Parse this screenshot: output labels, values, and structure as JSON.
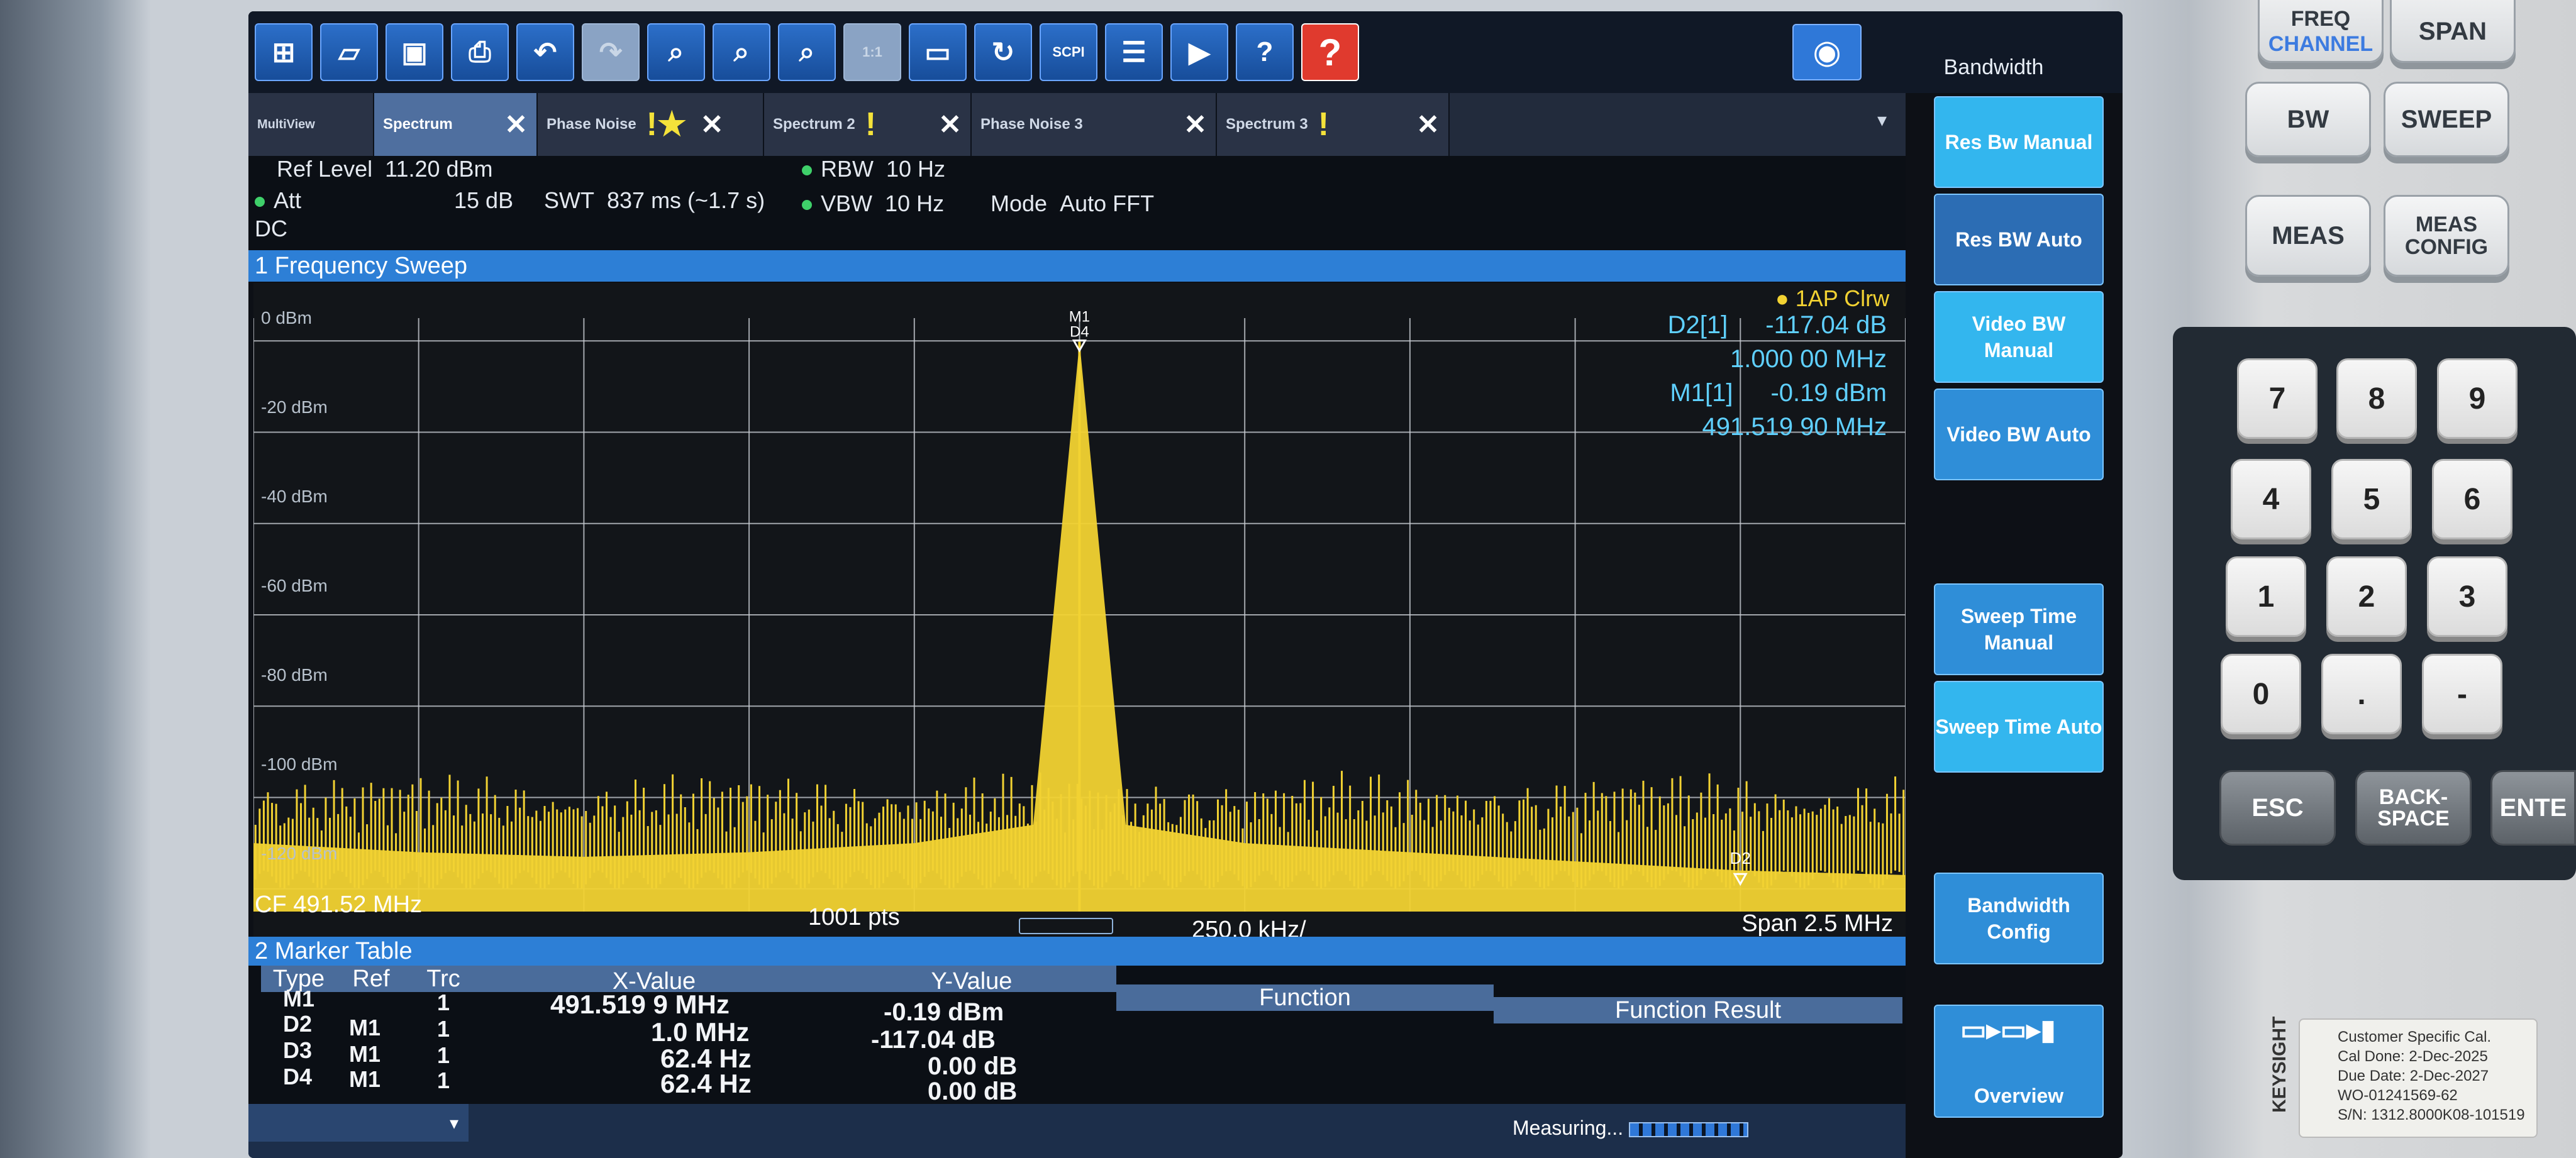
{
  "toolbar": {
    "icons": [
      "windows-icon",
      "open-folder-icon",
      "save-icon",
      "print-icon",
      "undo-icon",
      "redo-icon",
      "zoom-icon",
      "zoom-multi-icon",
      "zoom-off-icon",
      "zoom-1to1-icon",
      "full-screen-icon",
      "refresh-icon",
      "scpi-recorder-icon",
      "sequencer-icon",
      "display-icon",
      "help-pointer-icon",
      "help-icon"
    ],
    "scpi_label": "SCPI",
    "zoom_1to1_label": "1:1"
  },
  "softkey_panel": {
    "title": "Bandwidth",
    "keys": [
      {
        "label": "Res Bw Manual",
        "active": true
      },
      {
        "label": "Res BW Auto",
        "active": false
      },
      {
        "label": "Video BW Manual",
        "active": true
      },
      {
        "label": "Video BW Auto",
        "active": false
      },
      {
        "label": "Sweep Time Manual",
        "active": false
      },
      {
        "label": "Sweep Time Auto",
        "active": true
      },
      {
        "label": "Bandwidth Config",
        "active": false
      },
      {
        "label": "Overview",
        "active": false
      }
    ]
  },
  "tabs": [
    {
      "label": "MultiView",
      "active": false
    },
    {
      "label": "Spectrum",
      "active": true
    },
    {
      "label": "Phase Noise",
      "active": false
    },
    {
      "label": "Spectrum 2",
      "active": false
    },
    {
      "label": "Phase Noise 3",
      "active": false
    },
    {
      "label": "Spectrum 3",
      "active": false
    }
  ],
  "settings": {
    "ref_level_label": "Ref Level",
    "ref_level_value": "11.20 dBm",
    "att_label": "Att",
    "att_value": "15 dB",
    "swt_label": "SWT",
    "swt_value": "837 ms (~1.7 s)",
    "rbw_label": "RBW",
    "rbw_value": "10 Hz",
    "vbw_label": "VBW",
    "vbw_value": "10 Hz",
    "mode_label": "Mode",
    "mode_value": "Auto FFT",
    "coupling": "DC"
  },
  "diagram": {
    "title": "1 Frequency Sweep",
    "trace_label": "1AP Clrw",
    "y_ticks": [
      "0 dBm",
      "-20 dBm",
      "-40 dBm",
      "-60 dBm",
      "-80 dBm",
      "-100 dBm",
      "-120 dBm"
    ],
    "marker_labels": {
      "m1": "M1",
      "d4": "D4",
      "d2": "D2"
    },
    "marker_readout": [
      {
        "name": "D2[1]",
        "value": "-117.04 dB"
      },
      {
        "name": "",
        "value": "1.000 00 MHz"
      },
      {
        "name": "M1[1]",
        "value": "-0.19 dBm"
      },
      {
        "name": "",
        "value": "491.519 90 MHz"
      }
    ],
    "cf": "CF 491.52 MHz",
    "points": "1001 pts",
    "div": "250.0 kHz/",
    "span": "Span 2.5 MHz"
  },
  "chart_data": {
    "type": "line",
    "title": "1 Frequency Sweep",
    "xlabel": "",
    "ylabel": "",
    "x_center_mhz": 491.52,
    "x_span_mhz": 2.5,
    "ylim": [
      -125,
      5
    ],
    "y_ticks": [
      0,
      -20,
      -40,
      -60,
      -80,
      -100,
      -120
    ],
    "grid": true,
    "series": [
      {
        "name": "1AP Clrw",
        "color": "#f2d232",
        "x": [
          490.27,
          490.52,
          490.77,
          491.02,
          491.27,
          491.45,
          491.52,
          491.59,
          491.77,
          492.02,
          492.27,
          492.52,
          492.77
        ],
        "y": [
          -110,
          -112,
          -113,
          -112,
          -110,
          -106,
          -0.19,
          -106,
          -110,
          -112,
          -114,
          -116,
          -117
        ]
      }
    ],
    "markers": [
      {
        "name": "M1",
        "x": 491.5199,
        "y": -0.19
      },
      {
        "name": "D2",
        "x": 492.5199,
        "y": -117.04
      }
    ]
  },
  "marker_table": {
    "title": "2 Marker Table",
    "headers": {
      "type": "Type",
      "ref": "Ref",
      "trc": "Trc",
      "x": "X-Value",
      "y": "Y-Value",
      "function": "Function",
      "result": "Function Result"
    },
    "rows": [
      {
        "type": "M1",
        "ref": "",
        "trc": "1",
        "x": "491.519 9 MHz",
        "y": "-0.19 dBm"
      },
      {
        "type": "D2",
        "ref": "M1",
        "trc": "1",
        "x": "1.0 MHz",
        "y": "-117.04 dB"
      },
      {
        "type": "D3",
        "ref": "M1",
        "trc": "1",
        "x": "62.4 Hz",
        "y": "0.00 dB"
      },
      {
        "type": "D4",
        "ref": "M1",
        "trc": "1",
        "x": "62.4 Hz",
        "y": "0.00 dB"
      }
    ]
  },
  "status": {
    "measuring": "Measuring..."
  },
  "hardkeys": {
    "freq": "FREQ",
    "channel": "CHANNEL",
    "span": "SPAN",
    "bw": "BW",
    "sweep": "SWEEP",
    "meas": "MEAS",
    "meas_config": "MEAS CONFIG",
    "esc": "ESC",
    "backspace": "BACK- SPACE",
    "enter": "ENTE",
    "numbers": [
      "7",
      "8",
      "9",
      "4",
      "5",
      "6",
      "1",
      "2",
      "3",
      "0",
      ".",
      "-"
    ]
  },
  "cal_sticker": {
    "brand": "KEYSIGHT",
    "lines": [
      "Customer Specific Cal.",
      "Cal Done:     2-Dec-2025",
      "Due Date:     2-Dec-2027",
      "WO-01241569-62",
      "S/N: 1312.8000K08-101519"
    ]
  }
}
